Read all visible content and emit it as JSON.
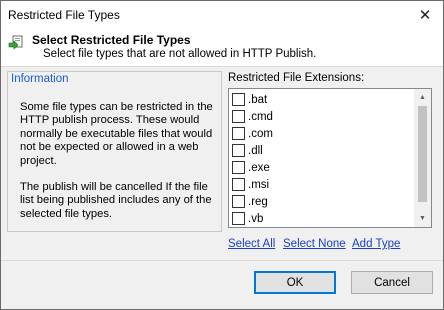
{
  "window": {
    "title": "Restricted File Types"
  },
  "header": {
    "title": "Select Restricted File Types",
    "subtitle": "Select file types that are not allowed in HTTP Publish."
  },
  "info": {
    "legend": "Information",
    "paragraph1": "Some file types can be restricted in the HTTP publish process.  These would normally be executable files that would not be expected or allowed in a web project.",
    "paragraph2": "The publish will be cancelled If the file list being published includes any of the selected file types."
  },
  "extensions": {
    "label": "Restricted File Extensions:",
    "items": [
      {
        "label": ".bat",
        "checked": false
      },
      {
        "label": ".cmd",
        "checked": false
      },
      {
        "label": ".com",
        "checked": false
      },
      {
        "label": ".dll",
        "checked": false
      },
      {
        "label": ".exe",
        "checked": false
      },
      {
        "label": ".msi",
        "checked": false
      },
      {
        "label": ".reg",
        "checked": false
      },
      {
        "label": ".vb",
        "checked": false
      }
    ]
  },
  "links": {
    "select_all": "Select All",
    "select_none": "Select None",
    "add_type": "Add Type"
  },
  "buttons": {
    "ok": "OK",
    "cancel": "Cancel"
  },
  "icons": {
    "close": "close-icon",
    "header": "restricted-files-icon"
  }
}
